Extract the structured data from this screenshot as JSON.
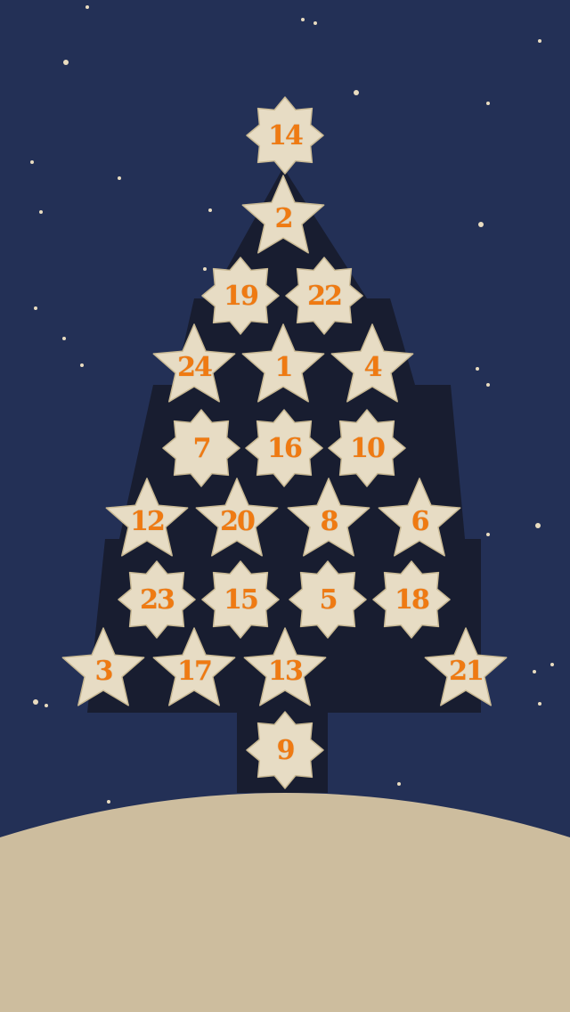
{
  "colors": {
    "sky": "#233056",
    "tree": "#181d30",
    "ground": "#cdbd9e",
    "star_fill": "#e7dcc4",
    "star_edge": "#c9b994",
    "number": "#ef7a12",
    "snow": "#e9dcc0"
  },
  "calendar": {
    "doors": [
      {
        "day": "14",
        "shape": "eight-point"
      },
      {
        "day": "2",
        "shape": "five-point"
      },
      {
        "day": "19",
        "shape": "eight-point"
      },
      {
        "day": "22",
        "shape": "eight-point"
      },
      {
        "day": "24",
        "shape": "five-point"
      },
      {
        "day": "1",
        "shape": "five-point"
      },
      {
        "day": "4",
        "shape": "five-point"
      },
      {
        "day": "7",
        "shape": "eight-point"
      },
      {
        "day": "16",
        "shape": "eight-point"
      },
      {
        "day": "10",
        "shape": "eight-point"
      },
      {
        "day": "12",
        "shape": "five-point"
      },
      {
        "day": "20",
        "shape": "five-point"
      },
      {
        "day": "8",
        "shape": "five-point"
      },
      {
        "day": "6",
        "shape": "five-point"
      },
      {
        "day": "23",
        "shape": "eight-point"
      },
      {
        "day": "15",
        "shape": "eight-point"
      },
      {
        "day": "5",
        "shape": "eight-point"
      },
      {
        "day": "18",
        "shape": "eight-point"
      },
      {
        "day": "3",
        "shape": "five-point"
      },
      {
        "day": "17",
        "shape": "five-point"
      },
      {
        "day": "13",
        "shape": "five-point"
      },
      {
        "day": "21",
        "shape": "five-point"
      },
      {
        "day": "9",
        "shape": "eight-point"
      }
    ]
  }
}
